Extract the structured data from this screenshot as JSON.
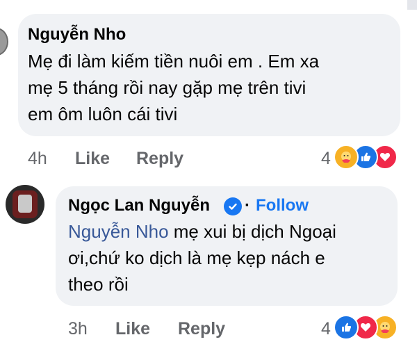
{
  "comment1": {
    "author": "Nguyễn Nho",
    "lines": [
      "Mẹ đi làm kiếm tiền nuôi em . Em xa",
      "mẹ 5 tháng rồi nay gặp mẹ trên tivi",
      "em ôm luôn cái tivi"
    ],
    "time": "4h",
    "like_label": "Like",
    "reply_label": "Reply",
    "reaction_count": "4",
    "reactions": [
      "care-icon",
      "like-icon",
      "love-icon"
    ]
  },
  "comment2": {
    "author": "Ngọc Lan Nguyễn",
    "separator": "·",
    "follow_label": "Follow",
    "mention": "Nguyễn Nho",
    "line1_rest": " mẹ xui bị dịch Ngoại",
    "line2": "ơi,chứ ko dịch là mẹ kẹp nách e",
    "line3": "theo rồi",
    "time": "3h",
    "like_label": "Like",
    "reply_label": "Reply",
    "reaction_count": "4",
    "reactions": [
      "like-icon",
      "love-icon",
      "care-icon"
    ]
  },
  "colors": {
    "bubble": "#f0f2f5",
    "meta": "#65676b",
    "link": "#385898",
    "follow": "#1877f2",
    "like": "#1b74e4",
    "love": "#f02849",
    "care": "#f7b125"
  }
}
